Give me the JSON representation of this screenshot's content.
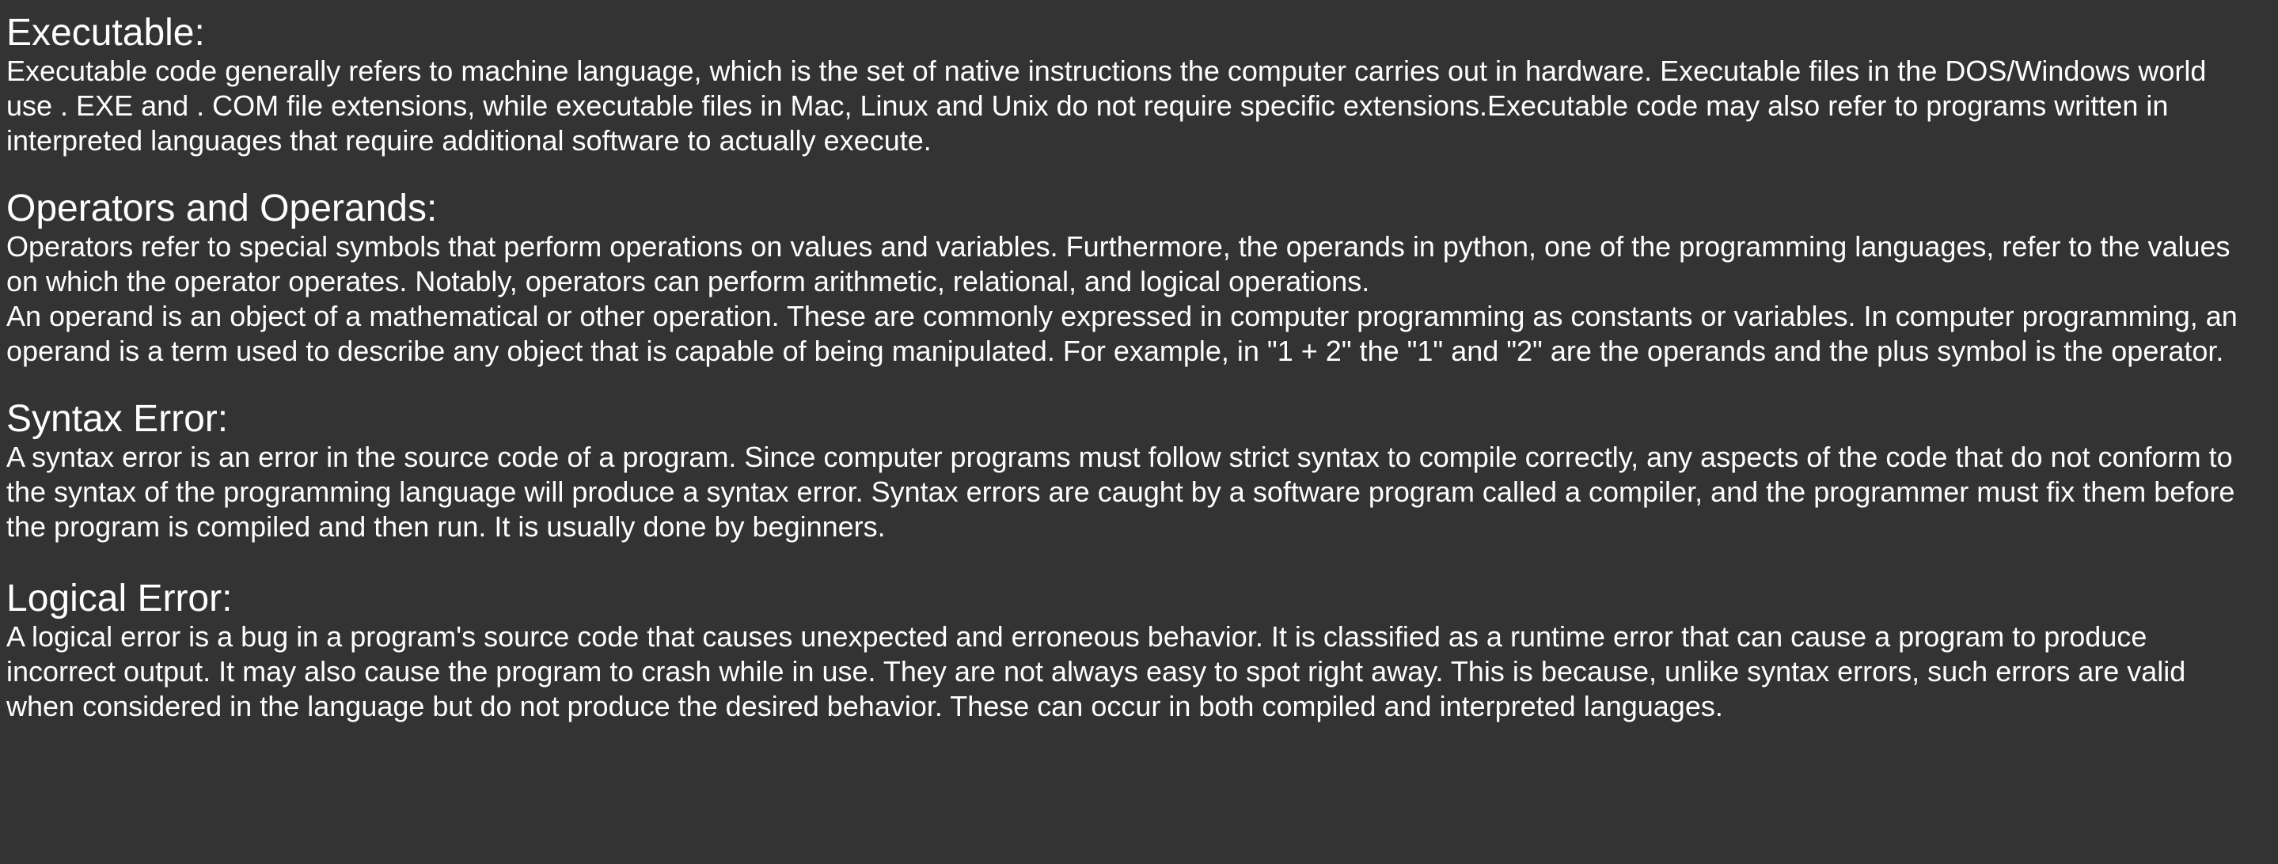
{
  "colors": {
    "background": "#333333",
    "text": "#ffffff"
  },
  "sections": [
    {
      "heading": "Executable:",
      "paragraphs": [
        "Executable code generally refers to machine language, which is the set of native instructions the computer carries out in hardware. Executable files in the DOS/Windows world use . EXE and . COM file extensions, while executable files in Mac, Linux and Unix do not require specific extensions.Executable code may also refer to programs written in interpreted languages that require additional software to actually execute."
      ]
    },
    {
      "heading": "Operators and Operands:",
      "paragraphs": [
        "Operators refer to special symbols that perform operations on values and variables. Furthermore, the operands in python, one of the programming languages, refer to the values on which the operator operates. Notably, operators can perform arithmetic, relational, and logical operations.",
        "An operand is an object of a mathematical or other operation. These are commonly expressed in computer programming as constants or variables. In computer programming, an operand is a term used to describe any object that is capable of being manipulated. For example, in \"1 + 2\" the \"1\" and \"2\" are the operands and the plus symbol is the operator."
      ]
    },
    {
      "heading": "Syntax Error:",
      "paragraphs": [
        "A syntax error is an error in the source code of a program. Since computer programs must follow strict syntax to compile correctly, any aspects of the code that do not conform to the syntax of the programming language will produce a syntax error. Syntax errors are caught by a software program called a compiler, and the programmer must fix them before the program is compiled and then run. It is usually done by beginners."
      ]
    },
    {
      "heading": "Logical Error:",
      "paragraphs": [
        "A logical error is a bug in a program's source code that causes unexpected and erroneous behavior. It is classified as a runtime error that can cause a program to produce incorrect output. It may also cause the program to crash while in use. They are not always easy to spot right away. This is because, unlike syntax errors, such errors are valid when considered in the language but do not produce the desired behavior. These can occur in both compiled and interpreted languages."
      ]
    }
  ]
}
